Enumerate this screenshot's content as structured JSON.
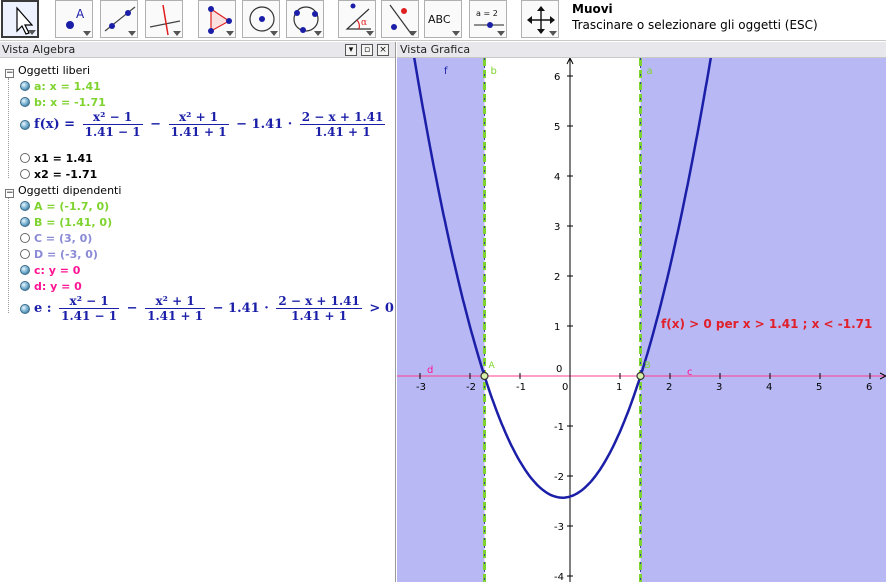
{
  "toolbar": {
    "help_name": "Muovi",
    "help_desc": "Trascinare o selezionare gli oggetti (ESC)",
    "tools": [
      "move-tool",
      "point-tool",
      "line-tool",
      "perpendicular-tool",
      "polygon-tool",
      "circle-center-tool",
      "circle-three-points-tool",
      "angle-tool",
      "reflect-tool",
      "text-tool",
      "slider-tool",
      "move-graphics-tool"
    ],
    "text_tool_label": "ABC",
    "slider_tool_label": "a = 2"
  },
  "algebra": {
    "title": "Vista Algebra",
    "free_group": "Oggetti liberi",
    "dependent_group": "Oggetti dipendenti",
    "free": {
      "a": "a: x = 1.41",
      "b": "b: x = -1.71",
      "f_prefix": "f(x) =",
      "f_frac1_num": "x² − 1",
      "f_frac1_den": "1.41 − 1",
      "f_minus": "−",
      "f_frac2_num": "x² + 1",
      "f_frac2_den": "1.41 + 1",
      "f_mid": "− 1.41 ·",
      "f_frac3_num": "2 − x + 1.41",
      "f_frac3_den": "1.41 + 1",
      "x1": "x1 = 1.41",
      "x2": "x2 = -1.71"
    },
    "dependent": {
      "A": "A = (-1.7, 0)",
      "B": "B = (1.41, 0)",
      "C": "C = (3, 0)",
      "D": "D = (-3, 0)",
      "c": "c: y = 0",
      "d": "d: y = 0",
      "e_prefix": "e :",
      "e_frac1_num": "x² − 1",
      "e_frac1_den": "1.41 − 1",
      "e_minus": "−",
      "e_frac2_num": "x² + 1",
      "e_frac2_den": "1.41 + 1",
      "e_mid": "− 1.41 ·",
      "e_frac3_num": "2 − x + 1.41",
      "e_frac3_den": "1.41 + 1",
      "e_suffix": "> 0"
    }
  },
  "graphics": {
    "title": "Vista Grafica",
    "inequality_label": "f(x) > 0 per x > 1.41 ; x < -1.71",
    "x_ticks": [
      -3,
      -2,
      -1,
      0,
      1,
      2,
      3,
      4,
      5,
      6
    ],
    "y_ticks": [
      -4,
      -3,
      -2,
      -1,
      1,
      2,
      3,
      4,
      5,
      6
    ],
    "labels": {
      "f": "f",
      "b": "b",
      "a": "a",
      "d": "d",
      "c": "c",
      "A": "A",
      "B": "B"
    },
    "x_min": -3.4,
    "x_max": 6.3,
    "y_min": -4.2,
    "y_max": 6.3,
    "roots": [
      -1.71,
      1.41
    ],
    "colors": {
      "shade": "#b8b8f5",
      "curve": "#1b1fa8",
      "vertical_lines": "#7fd32f",
      "axis_line": "#ff3c8c",
      "label_red": "#e0202a",
      "green_text": "#7fd32f",
      "pink_text": "#ff1493",
      "gray_blue_text": "#8a8ad6"
    }
  }
}
